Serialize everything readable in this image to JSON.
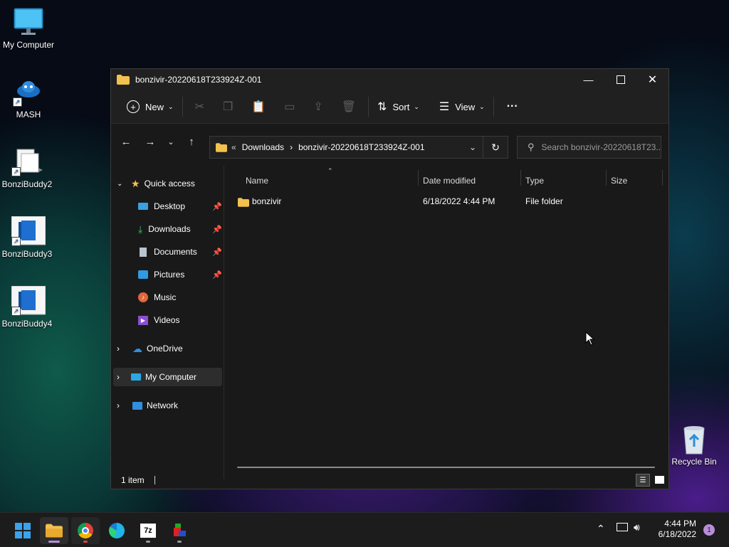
{
  "desktop": {
    "icons": [
      {
        "label": "My Computer",
        "icon": "monitor-icon"
      },
      {
        "label": "MASH",
        "icon": "mash-icon"
      },
      {
        "label": "BonziBuddy2",
        "icon": "file-icon"
      },
      {
        "label": "BonziBuddy3",
        "icon": "app-icon"
      },
      {
        "label": "BonziBuddy4",
        "icon": "app-icon"
      },
      {
        "label": "Recycle Bin",
        "icon": "recycle-bin-icon"
      }
    ]
  },
  "window": {
    "title": "bonzivir-20220618T233924Z-001",
    "commands": {
      "new_label": "New",
      "sort_label": "Sort",
      "view_label": "View",
      "more_label": "···"
    },
    "address": {
      "overflow": "«",
      "crumbs": [
        "Downloads",
        "bonzivir-20220618T233924Z-001"
      ]
    },
    "search_placeholder": "Search bonzivir-20220618T23...",
    "nav": {
      "quick_access": "Quick access",
      "pinned": [
        "Desktop",
        "Downloads",
        "Documents",
        "Pictures"
      ],
      "unpinned": [
        "Music",
        "Videos"
      ],
      "onedrive": "OneDrive",
      "my_computer": "My Computer",
      "network": "Network"
    },
    "columns": [
      "Name",
      "Date modified",
      "Type",
      "Size"
    ],
    "rows": [
      {
        "name": "bonzivir",
        "date": "6/18/2022 4:44 PM",
        "type": "File folder",
        "size": ""
      }
    ],
    "status": "1 item"
  },
  "taskbar": {
    "apps": [
      "start-icon",
      "file-explorer-icon",
      "chrome-icon",
      "edge-icon",
      "7zip-icon",
      "bonzi-icon"
    ],
    "time": "4:44 PM",
    "date": "6/18/2022",
    "notification_count": "1"
  },
  "colors": {
    "accent": "#0078d4",
    "folder": "#f2c14e",
    "window_bg": "#191919"
  }
}
